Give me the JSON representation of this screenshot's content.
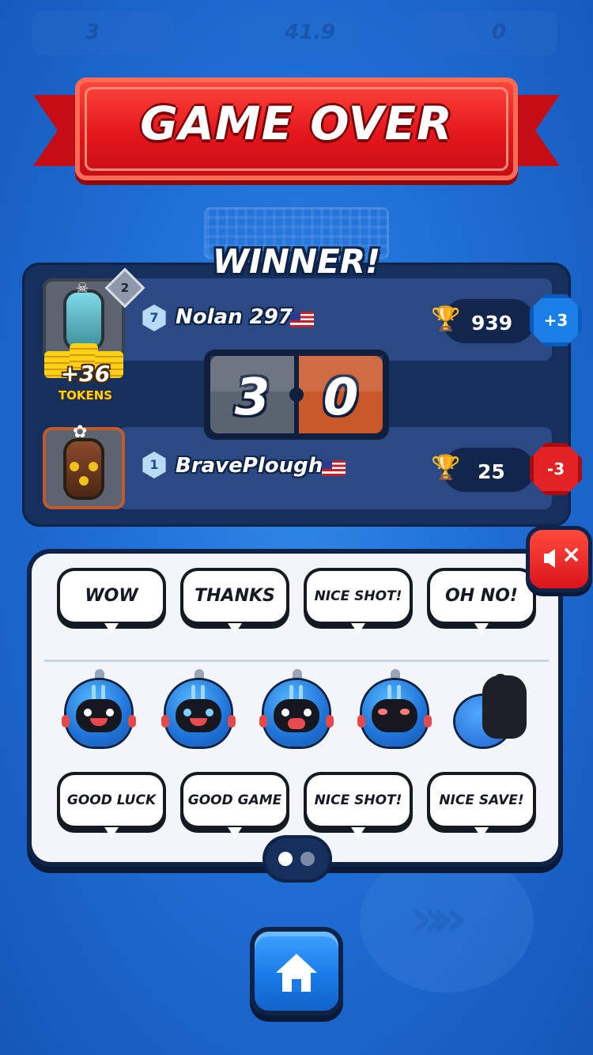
{
  "background_hud": {
    "left_value": "3",
    "timer": "41.9",
    "right_value": "0"
  },
  "banner": {
    "title": "GAME OVER"
  },
  "result": {
    "winner_label": "WINNER!",
    "score": {
      "left": "3",
      "right": "0"
    },
    "players": [
      {
        "name": "Nolan 297",
        "level": "7",
        "car_level": "2",
        "trophies": "939",
        "trophy_delta": "+3",
        "reward_amount": "+36",
        "reward_label": "TOKENS",
        "flag": "us-flag"
      },
      {
        "name": "BravePlough",
        "level": "1",
        "trophies": "25",
        "trophy_delta": "-3",
        "flag": "us-flag"
      }
    ]
  },
  "chat": {
    "phrases_top": [
      "WOW",
      "THANKS",
      "NICE SHOT!",
      "OH NO!"
    ],
    "emojis": [
      "laughing-bot-icon",
      "crying-bot-icon",
      "shouting-bot-icon",
      "blushing-bot-icon",
      "thumbs-up-icon"
    ],
    "phrases_bottom": [
      "GOOD LUCK",
      "GOOD GAME",
      "NICE SHOT!",
      "NICE SAVE!"
    ],
    "pager": {
      "pages": 2,
      "current": 1
    }
  },
  "icons": {
    "mute": "mute-speaker-icon",
    "home": "home-icon",
    "trophy": "trophy-icon"
  },
  "colors": {
    "accent_red": "#e5161c",
    "accent_blue": "#1a7be8",
    "panel_navy": "#16305e",
    "score_orange": "#c9582a"
  }
}
